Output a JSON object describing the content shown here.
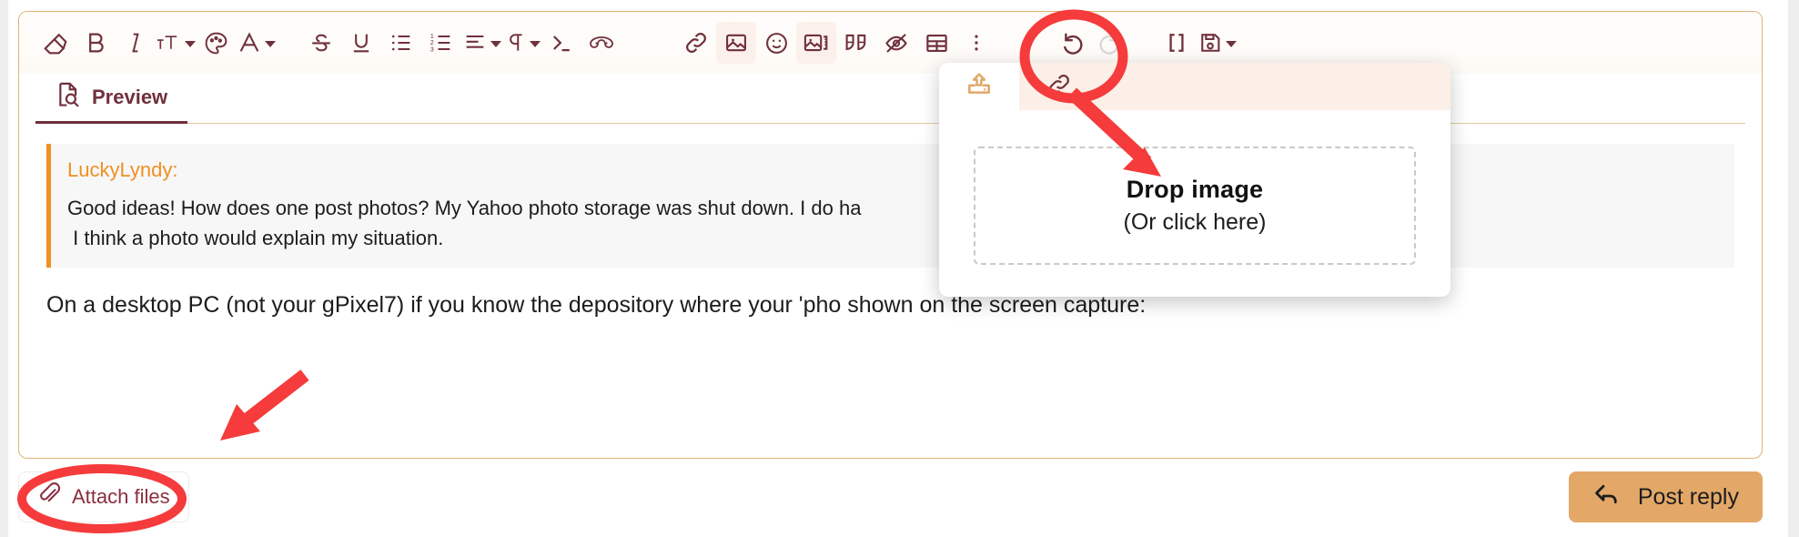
{
  "theme": {
    "accent_maroon": "#70303c",
    "accent_tan": "#e3a868",
    "quote_orange": "#ef9022",
    "annotation_red": "#f53b3b",
    "link_red": "#8b2d3f"
  },
  "toolbar": {
    "groups": [
      {
        "name": "format",
        "items": [
          {
            "icon": "eraser-icon",
            "label": "Clear formatting",
            "caret": false,
            "muted": false
          },
          {
            "icon": "bold-icon",
            "label": "Bold",
            "caret": false,
            "muted": false
          },
          {
            "icon": "italic-icon",
            "label": "Italic",
            "caret": false,
            "muted": false
          },
          {
            "icon": "font-size-icon",
            "label": "Font size",
            "caret": true,
            "muted": false
          },
          {
            "icon": "palette-icon",
            "label": "Background color",
            "caret": false,
            "muted": false
          },
          {
            "icon": "text-color-icon",
            "label": "Text color",
            "caret": true,
            "muted": false
          },
          {
            "icon": "strikethrough-icon",
            "label": "Strikethrough",
            "caret": false,
            "muted": false
          },
          {
            "icon": "underline-icon",
            "label": "Underline",
            "caret": false,
            "muted": false
          },
          {
            "icon": "bullet-list-icon",
            "label": "Bulleted list",
            "caret": false,
            "muted": false
          },
          {
            "icon": "numbered-list-icon",
            "label": "Numbered list",
            "caret": false,
            "muted": false
          },
          {
            "icon": "align-icon",
            "label": "Alignment",
            "caret": true,
            "muted": false
          },
          {
            "icon": "paragraph-icon",
            "label": "Paragraph format",
            "caret": true,
            "muted": false
          },
          {
            "icon": "code-icon",
            "label": "Code",
            "caret": false,
            "muted": false
          },
          {
            "icon": "spoiler-mask-icon",
            "label": "Inline spoiler",
            "caret": false,
            "muted": false
          }
        ]
      },
      {
        "name": "insert",
        "items": [
          {
            "icon": "link-icon",
            "label": "Insert link",
            "caret": false,
            "muted": false
          },
          {
            "icon": "image-icon",
            "label": "Insert image",
            "caret": false,
            "muted": false
          },
          {
            "icon": "emoji-icon",
            "label": "Insert emoji",
            "caret": false,
            "muted": false
          },
          {
            "icon": "media-gallery-icon",
            "label": "Insert image or media",
            "caret": false,
            "muted": false
          },
          {
            "icon": "quote-icon",
            "label": "Quote",
            "caret": false,
            "muted": false
          },
          {
            "icon": "spoiler-icon",
            "label": "Spoiler",
            "caret": false,
            "muted": false
          },
          {
            "icon": "table-icon",
            "label": "Table",
            "caret": false,
            "muted": false
          },
          {
            "icon": "more-options-icon",
            "label": "More options",
            "caret": false,
            "muted": false
          }
        ]
      },
      {
        "name": "history",
        "items": [
          {
            "icon": "undo-icon",
            "label": "Undo",
            "caret": false,
            "muted": false
          },
          {
            "icon": "redo-icon",
            "label": "Redo",
            "caret": false,
            "muted": true
          },
          {
            "icon": "brackets-icon",
            "label": "BB code",
            "caret": false,
            "muted": false
          },
          {
            "icon": "save-icon",
            "label": "Drafts",
            "caret": true,
            "muted": false
          }
        ]
      }
    ]
  },
  "tabs": [
    {
      "id": "preview",
      "label": "Preview",
      "icon": "document-search-icon",
      "selected": true
    }
  ],
  "editor": {
    "quote": {
      "author": "LuckyLyndy:",
      "text": "Good ideas! How does one post photos? My Yahoo photo storage was shut down. I do ha                                   e, and then post that here?\n I think a photo would explain my situation."
    },
    "paragraph": "On a desktop PC (not your gPixel7) if you know the depository where your 'pho                                    shown on the screen capture:"
  },
  "image_popup": {
    "tabs": [
      {
        "id": "upload",
        "icon": "upload-icon",
        "selected": true
      },
      {
        "id": "url",
        "icon": "link-icon",
        "selected": false
      }
    ],
    "dropzone": {
      "title": "Drop image",
      "subtitle": "(Or click here)"
    }
  },
  "footer": {
    "attach_label": "Attach files",
    "attach_icon": "paperclip-icon",
    "post_label": "Post reply",
    "post_icon": "reply-arrow-icon"
  },
  "annotations": [
    {
      "name": "media-button-highlight",
      "shape": "ellipse"
    },
    {
      "name": "arrow-to-dropzone",
      "shape": "arrow"
    },
    {
      "name": "attach-files-highlight",
      "shape": "ellipse"
    },
    {
      "name": "arrow-to-attach-files",
      "shape": "arrow"
    }
  ]
}
